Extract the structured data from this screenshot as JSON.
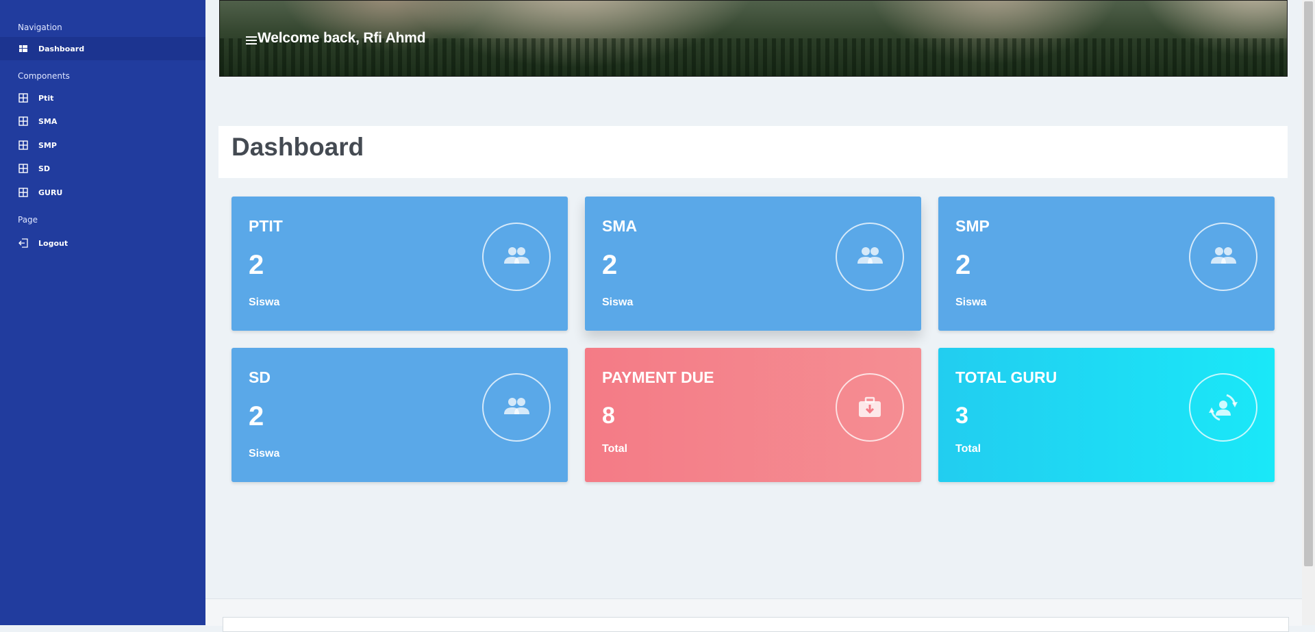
{
  "sidebar": {
    "sections": [
      {
        "heading": "Navigation",
        "items": [
          {
            "label": "Dashboard",
            "icon": "dashboard-icon",
            "active": true
          }
        ]
      },
      {
        "heading": "Components",
        "items": [
          {
            "label": "Ptit",
            "icon": "grid-icon"
          },
          {
            "label": "SMA",
            "icon": "grid-icon"
          },
          {
            "label": "SMP",
            "icon": "grid-icon"
          },
          {
            "label": "SD",
            "icon": "grid-icon"
          },
          {
            "label": "GURU",
            "icon": "grid-icon"
          }
        ]
      },
      {
        "heading": "Page",
        "items": [
          {
            "label": "Logout",
            "icon": "logout-icon"
          }
        ]
      }
    ]
  },
  "header": {
    "welcome": "Welcome back, Rfi Ahmd",
    "menu_icon": "hamburger-menu-icon"
  },
  "page": {
    "title": "Dashboard"
  },
  "cards": [
    {
      "title": "PTIT",
      "value": "2",
      "unit": "Siswa",
      "icon": "users-icon",
      "color": "#5aa8e8"
    },
    {
      "title": "SMA",
      "value": "2",
      "unit": "Siswa",
      "icon": "users-icon",
      "color": "#5aa8e8"
    },
    {
      "title": "SMP",
      "value": "2",
      "unit": "Siswa",
      "icon": "users-icon",
      "color": "#5aa8e8"
    },
    {
      "title": "SD",
      "value": "2",
      "unit": "Siswa",
      "icon": "users-icon",
      "color": "#5aa8e8"
    },
    {
      "title": "PAYMENT DUE",
      "value": "8",
      "unit": "Total",
      "icon": "briefcase-download-icon",
      "color": "#f47b86"
    },
    {
      "title": "TOTAL GURU",
      "value": "3",
      "unit": "Total",
      "icon": "user-sync-icon",
      "color": "#22cdf0"
    }
  ],
  "colors": {
    "sidebar_bg": "#213c9e",
    "sidebar_active": "#1c3490",
    "page_bg": "#edf2f6"
  }
}
